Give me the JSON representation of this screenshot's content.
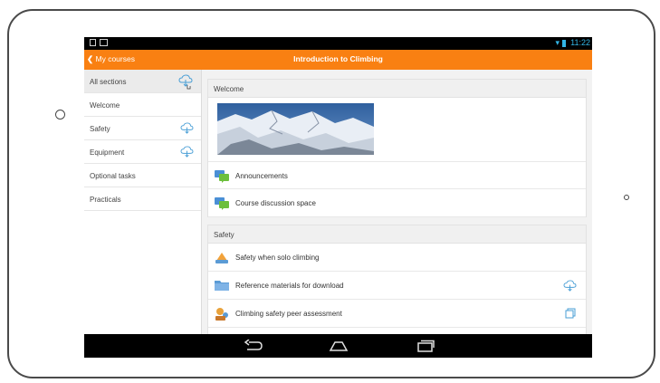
{
  "status_bar": {
    "time": "11:22",
    "wifi_icon": "wifi-icon",
    "battery_icon": "battery-icon"
  },
  "app_bar": {
    "back_label": "My courses",
    "title": "Introduction to Climbing"
  },
  "sidebar": {
    "items": [
      {
        "label": "All sections",
        "selected": true,
        "download_icon": true
      },
      {
        "label": "Welcome",
        "selected": false,
        "download_icon": false
      },
      {
        "label": "Safety",
        "selected": false,
        "download_icon": true
      },
      {
        "label": "Equipment",
        "selected": false,
        "download_icon": true
      },
      {
        "label": "Optional tasks",
        "selected": false,
        "download_icon": false
      },
      {
        "label": "Practicals",
        "selected": false,
        "download_icon": false
      }
    ]
  },
  "sections": [
    {
      "title": "Welcome",
      "image": "mountain-banner",
      "modules": [
        {
          "label": "Announcements",
          "icon": "forum-icon"
        },
        {
          "label": "Course discussion space",
          "icon": "forum-icon"
        }
      ]
    },
    {
      "title": "Safety",
      "modules": [
        {
          "label": "Safety when solo climbing",
          "icon": "lesson-icon"
        },
        {
          "label": "Reference materials for download",
          "icon": "folder-icon",
          "action_icon": "cloud-download-icon"
        },
        {
          "label": "Climbing safety peer assessment",
          "icon": "workshop-icon",
          "action_icon": "open-icon"
        }
      ]
    }
  ],
  "colors": {
    "accent": "#f98012",
    "status_blue": "#33b5e5"
  },
  "nav_bar": {
    "icons": [
      "back-nav-icon",
      "home-nav-icon",
      "recents-nav-icon"
    ]
  }
}
